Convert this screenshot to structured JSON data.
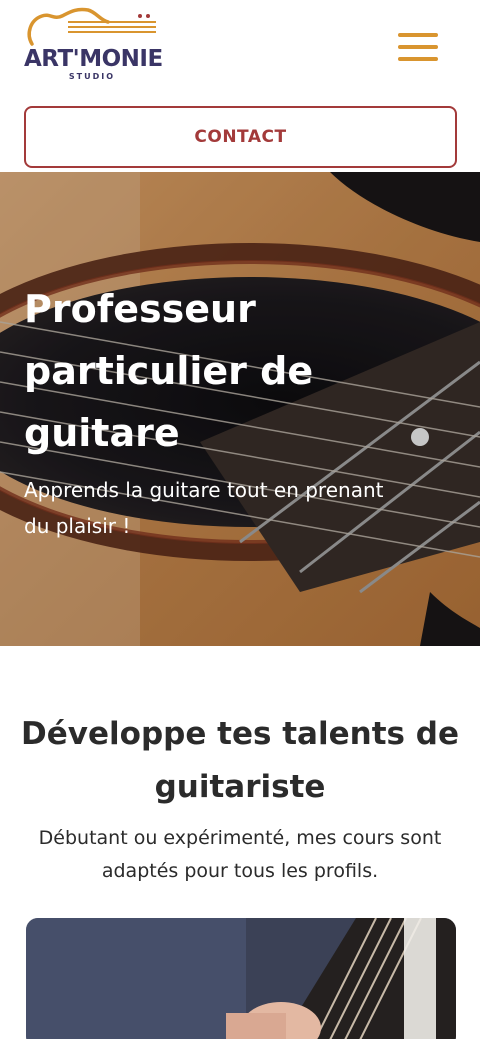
{
  "header": {
    "logo": {
      "brand": "ART'MONIE",
      "subtitle": "STUDIO"
    },
    "menu_icon": "hamburger-menu-icon"
  },
  "contact_button": {
    "label": "CONTACT"
  },
  "hero": {
    "title": "Professeur particulier de guitare",
    "subtitle": "Apprends la guitare tout en prenant du plaisir !"
  },
  "section": {
    "title": "Développe tes talents de guitariste",
    "text": "Débutant ou expérimenté, mes cours sont adaptés pour tous les profils."
  },
  "colors": {
    "accent": "#d9952f",
    "brand": "#3a3566",
    "contact": "#a33a3a"
  }
}
